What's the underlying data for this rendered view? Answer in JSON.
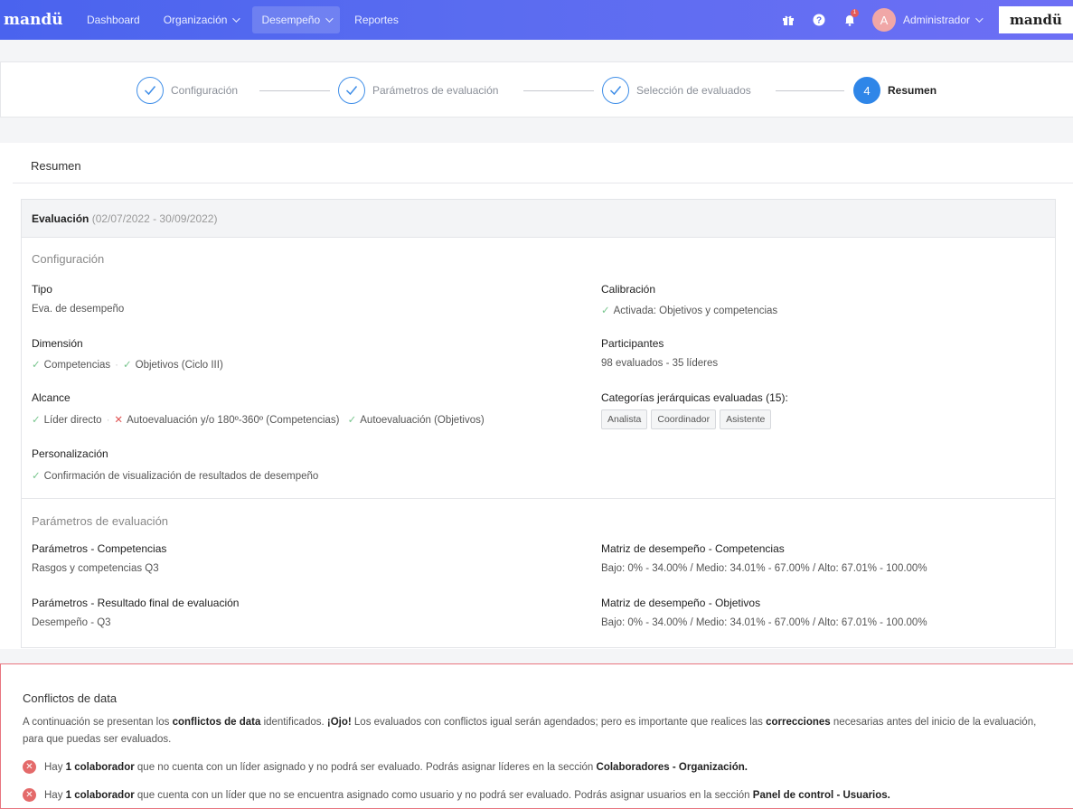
{
  "nav": {
    "brand": "mandü",
    "items": [
      {
        "label": "Dashboard"
      },
      {
        "label": "Organización"
      },
      {
        "label": "Desempeño"
      },
      {
        "label": "Reportes"
      }
    ],
    "notification_count": "1",
    "user_initial": "A",
    "user_name": "Administrador",
    "logo_text": "mandü"
  },
  "stepper": {
    "steps": [
      {
        "label": "Configuración",
        "state": "done"
      },
      {
        "label": "Parámetros de evaluación",
        "state": "done"
      },
      {
        "label": "Selección de evaluados",
        "state": "done"
      },
      {
        "label": "Resumen",
        "number": "4",
        "state": "active"
      }
    ]
  },
  "summary": {
    "title": "Resumen",
    "eval_label": "Evaluación",
    "eval_dates": "(02/07/2022 - 30/09/2022)",
    "config": {
      "heading": "Configuración",
      "tipo_label": "Tipo",
      "tipo_value": "Eva. de desempeño",
      "dimension_label": "Dimensión",
      "dimension_1": "Competencias",
      "dimension_2": "Objetivos (Ciclo III)",
      "alcance_label": "Alcance",
      "alcance_1": "Líder directo",
      "alcance_2": "Autoevaluación y/o 180º-360º (Competencias)",
      "alcance_3": "Autoevaluación (Objetivos)",
      "personalizacion_label": "Personalización",
      "personalizacion_value": "Confirmación de visualización de resultados de desempeño",
      "calibracion_label": "Calibración",
      "calibracion_value": "Activada: Objetivos y competencias",
      "participantes_label": "Participantes",
      "participantes_value": "98 evaluados - 35 líderes",
      "categorias_label": "Categorías jerárquicas evaluadas (15):",
      "categorias": [
        "Analista",
        "Coordinador",
        "Asistente"
      ]
    },
    "params": {
      "heading": "Parámetros de evaluación",
      "comp_label": "Parámetros - Competencias",
      "comp_value": "Rasgos y competencias Q3",
      "final_label": "Parámetros - Resultado final de evaluación",
      "final_value": "Desempeño - Q3",
      "matriz_comp_label": "Matriz de desempeño - Competencias",
      "matriz_comp_value": "Bajo: 0% - 34.00% / Medio: 34.01% - 67.00% / Alto: 67.01% - 100.00%",
      "matriz_obj_label": "Matriz de desempeño - Objetivos",
      "matriz_obj_value": "Bajo: 0% - 34.00% / Medio: 34.01% - 67.00% / Alto: 67.01% - 100.00%"
    }
  },
  "conflicts": {
    "title": "Conflictos de data",
    "intro_1": "A continuación se presentan los ",
    "intro_b1": "conflictos de data",
    "intro_2": " identificados. ",
    "intro_b2": "¡Ojo!",
    "intro_3": " Los evaluados con conflictos igual serán agendados; pero es importante que realices las ",
    "intro_b3": "correcciones",
    "intro_4": " necesarias antes del inicio de la evaluación, para que puedas ser evaluados.",
    "item1_a": "Hay ",
    "item1_b": "1 colaborador",
    "item1_c": " que no cuenta con un líder asignado y no podrá ser evaluado. Podrás asignar líderes en la sección ",
    "item1_d": "Colaboradores - Organización.",
    "item2_a": "Hay ",
    "item2_b": "1 colaborador",
    "item2_c": " que cuenta con un líder que no se encuentra asignado como usuario y no podrá ser evaluado. Podrás asignar usuarios en la sección ",
    "item2_d": "Panel de control - Usuarios."
  }
}
